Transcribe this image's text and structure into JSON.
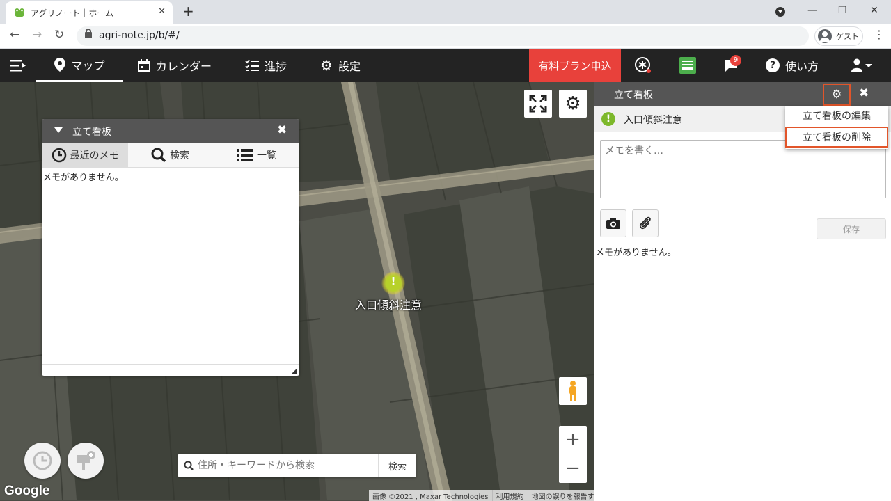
{
  "browser": {
    "tab_title": "アグリノート｜ホーム",
    "url": "agri-note.jp/b/#/",
    "profile_label": "ゲスト"
  },
  "nav": {
    "map": "マップ",
    "calendar": "カレンダー",
    "progress": "進捗",
    "settings": "設定",
    "paid_plan": "有料プラン申込",
    "notification_count": "9",
    "help": "使い方"
  },
  "map": {
    "pin_label": "入口傾斜注意",
    "search_placeholder": "住所・キーワードから検索",
    "search_button": "検索",
    "google_logo": "Google",
    "attribution": [
      "画像 ©2021 , Maxar Technologies",
      "利用規約",
      "地図の誤りを報告する"
    ]
  },
  "float_panel": {
    "title": "立て看板",
    "tabs": [
      "最近のメモ",
      "検索",
      "一覧"
    ],
    "empty_text": "メモがありません。"
  },
  "side_panel": {
    "title": "立て看板",
    "memo_name": "入口傾斜注意",
    "memo_placeholder": "メモを書く…",
    "save_label": "保存",
    "empty_text": "メモがありません。",
    "menu_items": [
      "立て看板の編集",
      "立て看板の削除"
    ]
  },
  "colors": {
    "accent_red": "#e8413b",
    "highlight_orange": "#e2552a",
    "nav_bg": "#232323",
    "panel_header": "#555555",
    "pin_green": "#7db82b"
  }
}
